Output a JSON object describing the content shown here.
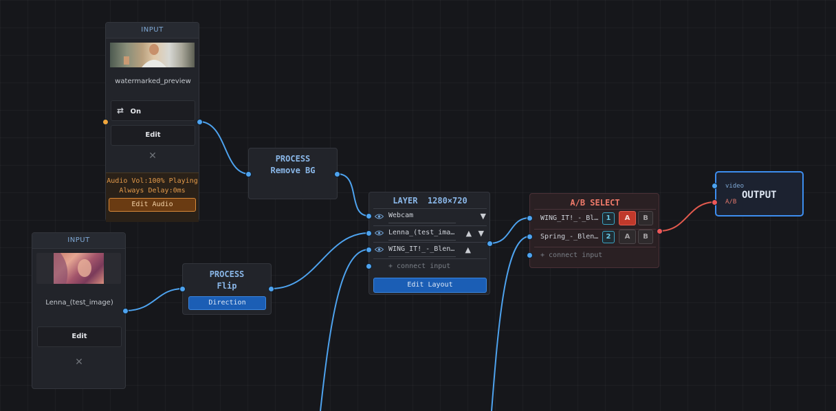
{
  "input_node_1": {
    "header": "INPUT",
    "filename": "watermarked_preview",
    "loop_label": "On",
    "edit_label": "Edit",
    "close_glyph": "✕",
    "audio_status_1": "Audio  Vol:100%  Playing",
    "audio_status_2": "Always  Delay:0ms",
    "edit_audio_label": "Edit Audio"
  },
  "input_node_2": {
    "header": "INPUT",
    "filename": "Lenna_(test_image)",
    "edit_label": "Edit",
    "close_glyph": "✕"
  },
  "process_remove_bg": {
    "title": "PROCESS",
    "subtitle": "Remove BG"
  },
  "process_flip": {
    "title": "PROCESS",
    "subtitle": "Flip",
    "direction_label": "Direction"
  },
  "layer_node": {
    "title": "LAYER",
    "resolution": "1280×720",
    "rows": [
      {
        "label": "Webcam",
        "arrows": "▼"
      },
      {
        "label": "Lenna_(test_ima…",
        "arrows": "▲ ▼"
      },
      {
        "label": "WING_IT!_-_Blen…",
        "arrows": "▲"
      }
    ],
    "connect_label": "+ connect input",
    "edit_layout_label": "Edit Layout"
  },
  "ab_select_node": {
    "title": "A/B SELECT",
    "rows": [
      {
        "label": "WING_IT!_-_Bl…",
        "num": "1",
        "a": "A",
        "b": "B"
      },
      {
        "label": "Spring_-_Blen…",
        "num": "2",
        "a": "A",
        "b": "B"
      }
    ],
    "connect_label": "+ connect input"
  },
  "output_node": {
    "title": "OUTPUT",
    "port_video": "video",
    "port_ab": "A/B"
  },
  "colors": {
    "accent_blue": "#4ea3ef",
    "wire_red": "#e25a4e",
    "output_border": "#3d8ef0",
    "ab_select_title": "#f07a6a",
    "active_a": "#c0392b"
  }
}
